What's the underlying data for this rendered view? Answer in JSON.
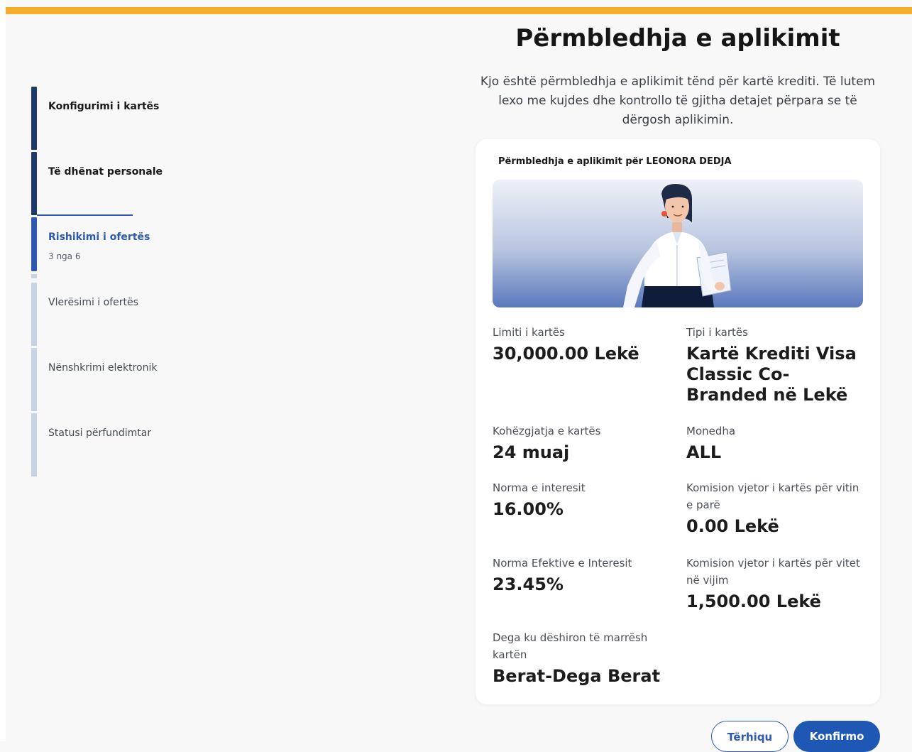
{
  "colors": {
    "accent_bar": "#f5ad2c",
    "primary": "#1f57b5",
    "step_done": "#1f3a68",
    "step_pending": "#c9d2e3"
  },
  "stepper": {
    "steps": [
      {
        "label": "Konfigurimi i kartës",
        "state": "done"
      },
      {
        "label": "Të dhënat personale",
        "state": "done"
      },
      {
        "label": "Rishikimi i ofertës",
        "state": "active",
        "sub": "3 nga 6"
      },
      {
        "label": "Vlerësimi i ofertës",
        "state": "pending"
      },
      {
        "label": "Nënshkrimi elektronik",
        "state": "pending"
      },
      {
        "label": "Statusi përfundimtar",
        "state": "pending"
      }
    ]
  },
  "header": {
    "title": "Përmbledhja e aplikimit",
    "intro": "Kjo është përmbledhja e aplikimit tënd për kartë krediti. Të lutem lexo me kujdes dhe kontrollo të gjitha detajet përpara se të dërgosh aplikimin."
  },
  "summary": {
    "card_title": "Përmbledhja e aplikimit për LEONORA DEDJA",
    "fields": {
      "limit": {
        "label": "Limiti i kartës",
        "value": "30,000.00 Lekë"
      },
      "card_type": {
        "label": "Tipi i kartës",
        "value": "Kartë Krediti Visa Classic Co-Branded në Lekë"
      },
      "duration": {
        "label": "Kohëzgjatja e kartës",
        "value": "24 muaj"
      },
      "currency": {
        "label": "Monedha",
        "value": "ALL"
      },
      "interest": {
        "label": "Norma e interesit",
        "value": "16.00%"
      },
      "fee_first_year": {
        "label": "Komision vjetor i kartës për vitin e parë",
        "value": "0.00 Lekë"
      },
      "effective_interest": {
        "label": "Norma Efektive e Interesit",
        "value": "23.45%"
      },
      "fee_next_years": {
        "label": "Komision vjetor i kartës për vitet në vijim",
        "value": "1,500.00 Lekë"
      },
      "branch": {
        "label": "Dega ku dëshiron të marrësh kartën",
        "value": "Berat-Dega Berat"
      }
    }
  },
  "actions": {
    "back_label": "Tërhiqu",
    "confirm_label": "Konfirmo"
  }
}
